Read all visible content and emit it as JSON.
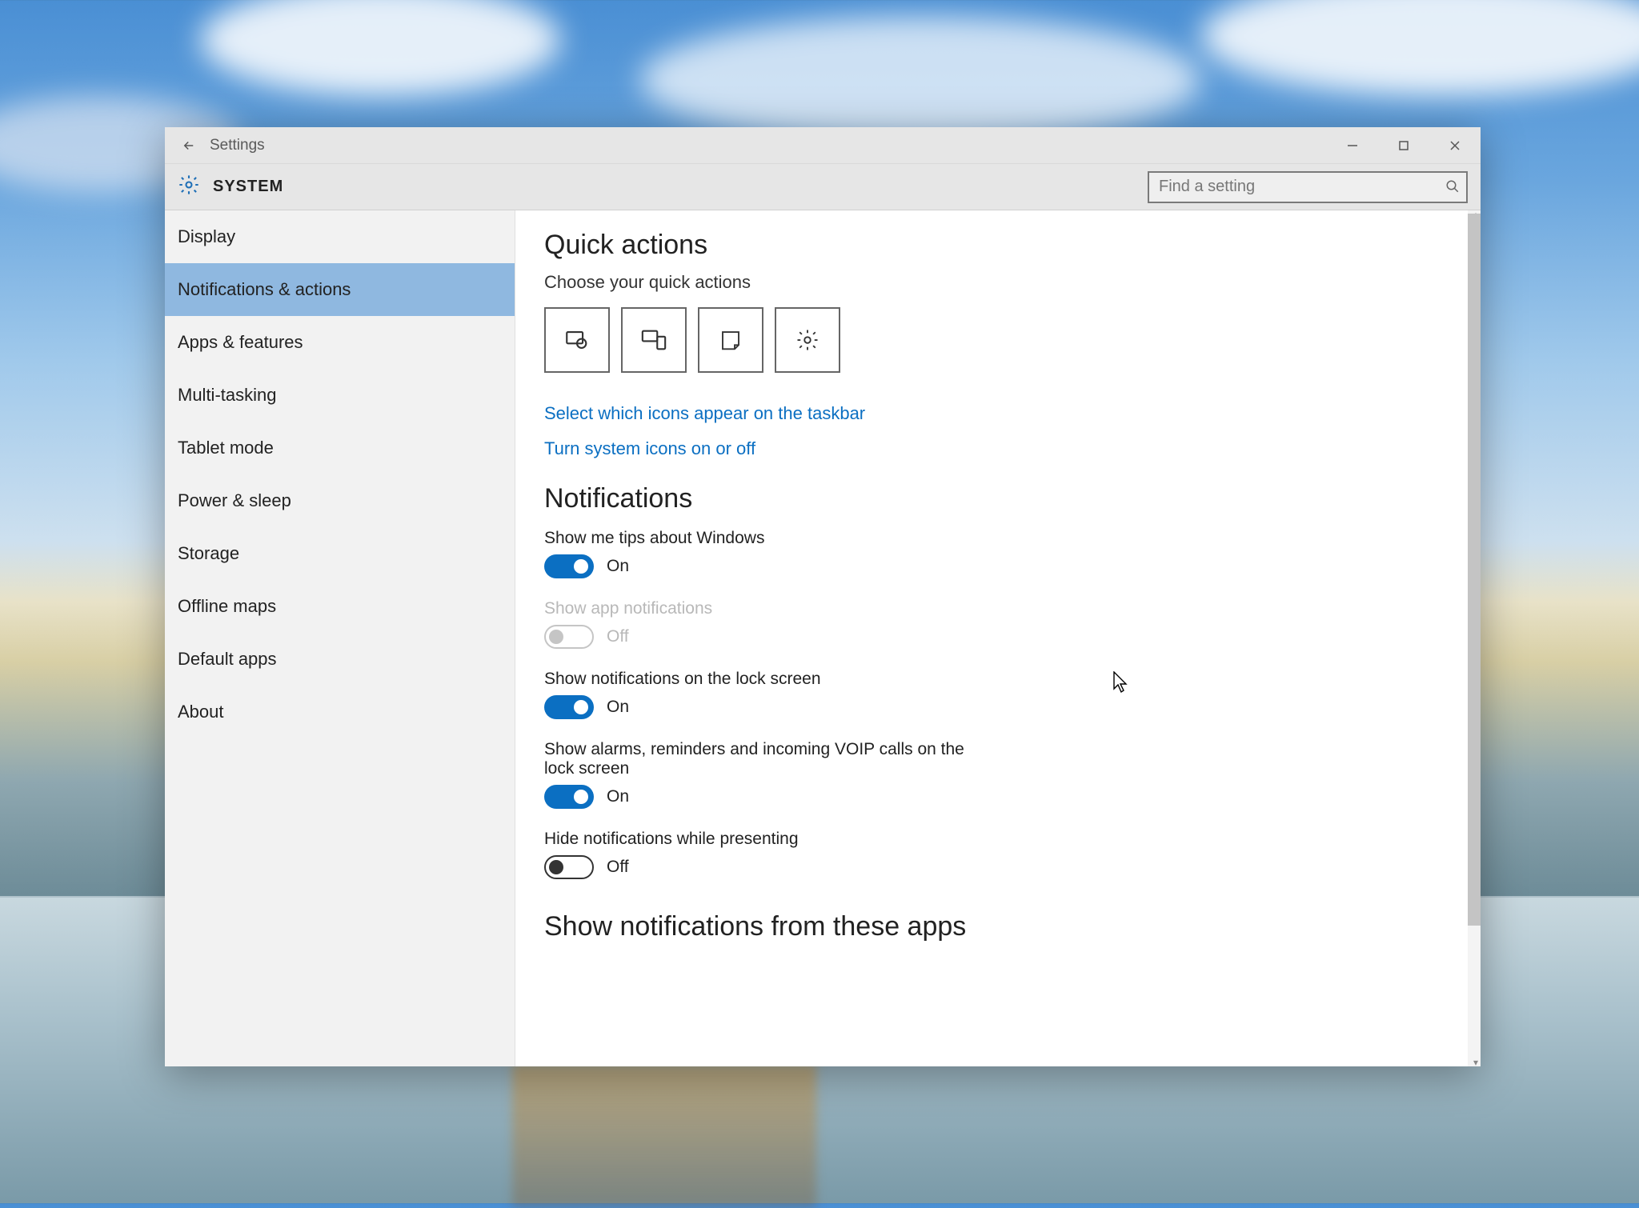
{
  "window": {
    "app_title": "Settings",
    "breadcrumb": "SYSTEM"
  },
  "search": {
    "placeholder": "Find a setting"
  },
  "sidebar": {
    "items": [
      {
        "label": "Display"
      },
      {
        "label": "Notifications & actions"
      },
      {
        "label": "Apps & features"
      },
      {
        "label": "Multi-tasking"
      },
      {
        "label": "Tablet mode"
      },
      {
        "label": "Power & sleep"
      },
      {
        "label": "Storage"
      },
      {
        "label": "Offline maps"
      },
      {
        "label": "Default apps"
      },
      {
        "label": "About"
      }
    ],
    "selected_index": 1
  },
  "main": {
    "quick_actions": {
      "heading": "Quick actions",
      "subtext": "Choose your quick actions",
      "tiles": [
        "tablet-mode-icon",
        "connect-icon",
        "note-icon",
        "all-settings-icon"
      ],
      "link_taskbar": "Select which icons appear on the taskbar",
      "link_system_icons": "Turn system icons on or off"
    },
    "notifications": {
      "heading": "Notifications",
      "settings": [
        {
          "label": "Show me tips about Windows",
          "state": "on",
          "state_text": "On",
          "enabled": true
        },
        {
          "label": "Show app notifications",
          "state": "off",
          "state_text": "Off",
          "enabled": false
        },
        {
          "label": "Show notifications on the lock screen",
          "state": "on",
          "state_text": "On",
          "enabled": true
        },
        {
          "label": "Show alarms, reminders and incoming VOIP calls on the lock screen",
          "state": "on",
          "state_text": "On",
          "enabled": true
        },
        {
          "label": "Hide notifications while presenting",
          "state": "off",
          "state_text": "Off",
          "enabled": true
        }
      ]
    },
    "apps_heading": "Show notifications from these apps"
  }
}
